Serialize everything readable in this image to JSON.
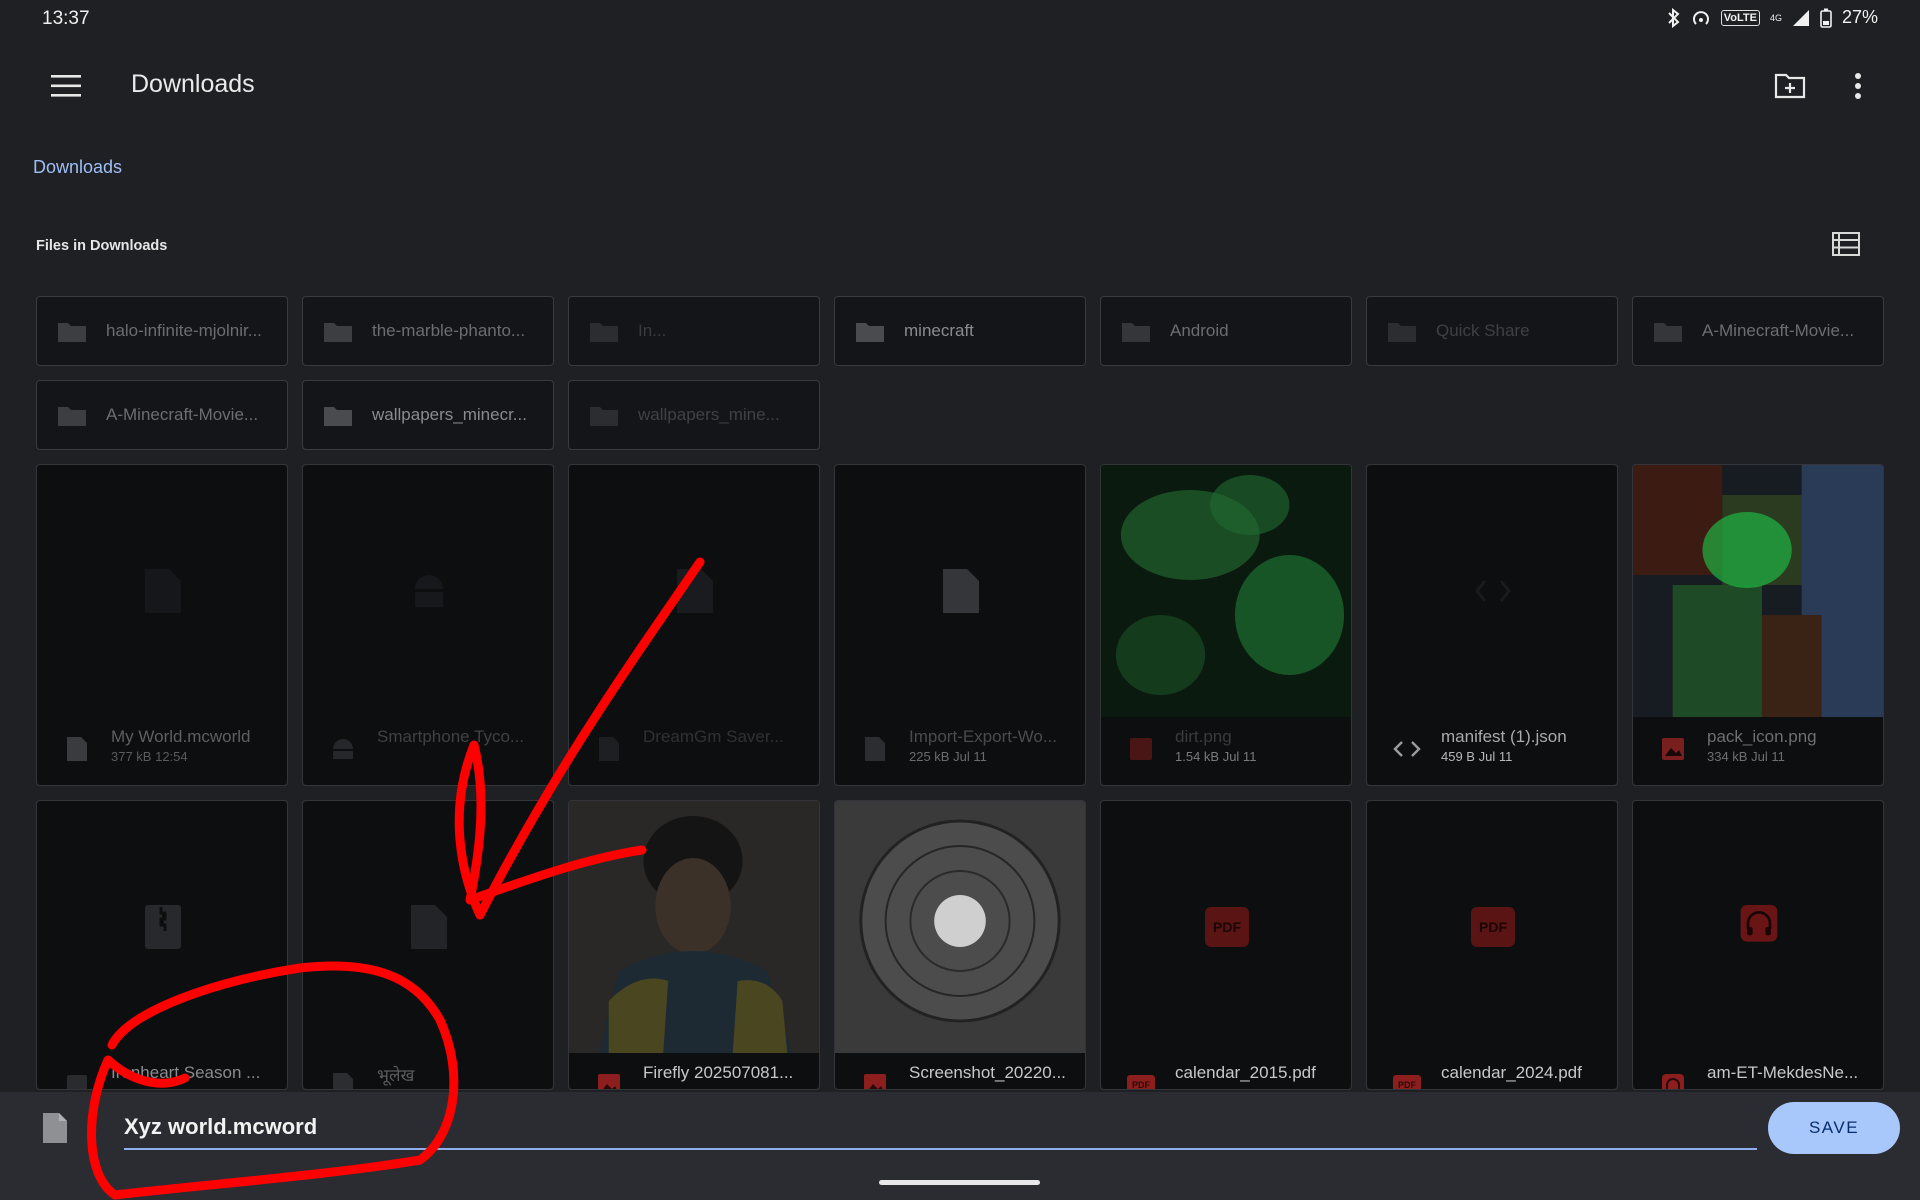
{
  "status_bar": {
    "time": "13:37",
    "network": "4G",
    "volte": "VoLTE",
    "battery": "27%"
  },
  "toolbar": {
    "title": "Downloads",
    "icons": [
      "menu-icon",
      "new-folder-icon",
      "more-vert-icon"
    ]
  },
  "breadcrumb": "Downloads",
  "section_label": "Files in Downloads",
  "folders": [
    {
      "name": "halo-infinite-mjolnir..."
    },
    {
      "name": "the-marble-phanto..."
    },
    {
      "name": "In..."
    },
    {
      "name": "minecraft"
    },
    {
      "name": "Android"
    },
    {
      "name": "Quick Share"
    },
    {
      "name": "A-Minecraft-Movie..."
    },
    {
      "name": "A-Minecraft-Movie..."
    },
    {
      "name": "wallpapers_minecr..."
    },
    {
      "name": "wallpapers_mine..."
    }
  ],
  "files": [
    {
      "name": "My World.mcworld",
      "meta": "377 kB 12:54",
      "type": "file"
    },
    {
      "name": "Smartphone Tyco...",
      "meta": "",
      "type": "android"
    },
    {
      "name": "DreamGm Saver...",
      "meta": "",
      "type": "file"
    },
    {
      "name": "Import-Export-Wo...",
      "meta": "225 kB Jul 11",
      "type": "file"
    },
    {
      "name": "dirt.png",
      "meta": "1.54 kB Jul 11",
      "type": "image"
    },
    {
      "name": "manifest (1).json",
      "meta": "459 B Jul 11",
      "type": "code"
    },
    {
      "name": "pack_icon.png",
      "meta": "334 kB Jul 11",
      "type": "image"
    },
    {
      "name": "Ironheart Season ...",
      "meta": "",
      "type": "archive"
    },
    {
      "name": "भूलेख",
      "meta": "",
      "type": "file"
    },
    {
      "name": "Firefly 202507081...",
      "meta": "",
      "type": "image"
    },
    {
      "name": "Screenshot_20220...",
      "meta": "",
      "type": "image"
    },
    {
      "name": "calendar_2015.pdf",
      "meta": "",
      "type": "pdf"
    },
    {
      "name": "calendar_2024.pdf",
      "meta": "",
      "type": "pdf"
    },
    {
      "name": "am-ET-MekdesNe...",
      "meta": "",
      "type": "audio"
    }
  ],
  "pdf_badge": "PDF",
  "save_bar": {
    "filename": "Xyz world.mcword",
    "save_label": "SAVE"
  },
  "colors": {
    "background": "#1f2024",
    "accent": "#a8c7fa",
    "annotation": "#ff0000"
  }
}
